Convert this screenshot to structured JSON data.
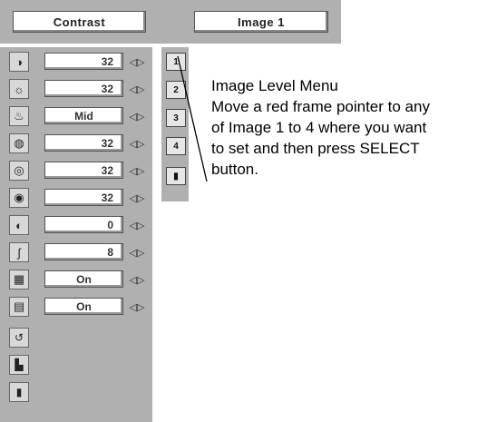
{
  "header": {
    "left_label": "Contrast",
    "right_label": "Image 1"
  },
  "rows": [
    {
      "icon": "contrast-icon",
      "glyph": "◑",
      "value": "32"
    },
    {
      "icon": "brightness-icon",
      "glyph": "☼",
      "value": "32"
    },
    {
      "icon": "color-temp-icon",
      "glyph": "♨",
      "value": "Mid"
    },
    {
      "icon": "red-icon",
      "glyph": "◍",
      "value": "32"
    },
    {
      "icon": "green-icon",
      "glyph": "◎",
      "value": "32"
    },
    {
      "icon": "blue-icon",
      "glyph": "◉",
      "value": "32"
    },
    {
      "icon": "sharpness-icon",
      "glyph": "◐",
      "value": "0"
    },
    {
      "icon": "gamma-icon",
      "glyph": "∫",
      "value": "8"
    },
    {
      "icon": "noise-reduction-icon",
      "glyph": "▦",
      "value": "On"
    },
    {
      "icon": "progressive-icon",
      "glyph": "▤",
      "value": "On"
    }
  ],
  "bottom_icons": [
    "reset-icon",
    "store-icon",
    "quit-icon"
  ],
  "image_items": [
    "1",
    "2",
    "3",
    "4"
  ],
  "note": {
    "lines": [
      "Image Level Menu",
      "Move a red frame pointer to any",
      "of Image 1 to 4 where you want",
      "to set  and then press SELECT",
      "button."
    ]
  }
}
